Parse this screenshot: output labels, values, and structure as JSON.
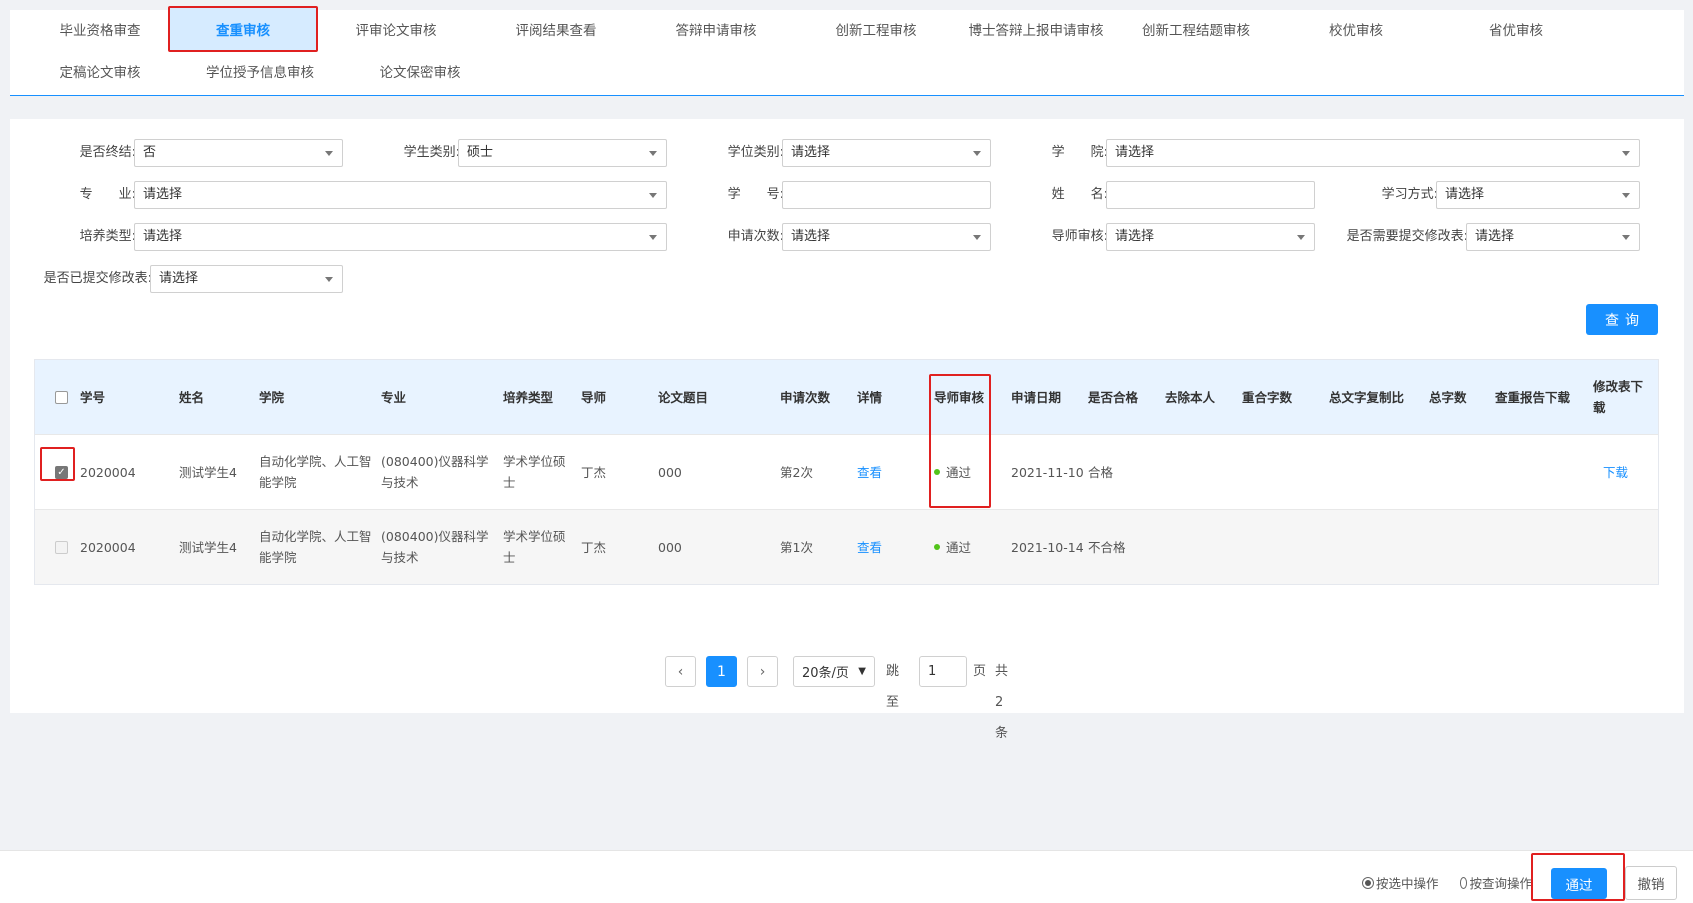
{
  "nav": {
    "tabs": [
      {
        "label": "毕业资格审查"
      },
      {
        "label": "查重审核"
      },
      {
        "label": "评审论文审核"
      },
      {
        "label": "评阅结果查看"
      },
      {
        "label": "答辩申请审核"
      },
      {
        "label": "创新工程审核"
      },
      {
        "label": "博士答辩上报申请审核"
      },
      {
        "label": "创新工程结题审核"
      },
      {
        "label": "校优审核"
      },
      {
        "label": "省优审核"
      },
      {
        "label": "定稿论文审核"
      },
      {
        "label": "学位授予信息审核"
      },
      {
        "label": "论文保密审核"
      }
    ],
    "active_tab": "查重审核"
  },
  "filters": {
    "is_final": {
      "label": "是否终结:",
      "value": "否"
    },
    "student_type": {
      "label": "学生类别:",
      "value": "硕士"
    },
    "degree_type": {
      "label": "学位类别:",
      "value": "请选择"
    },
    "college": {
      "label": "学　　院:",
      "value": "请选择"
    },
    "major": {
      "label": "专　　业:",
      "value": "请选择"
    },
    "student_no": {
      "label": "学　　号:",
      "value": ""
    },
    "name": {
      "label": "姓　　名:",
      "value": ""
    },
    "study_mode": {
      "label": "学习方式:",
      "value": "请选择"
    },
    "training_type": {
      "label": "培养类型:",
      "value": "请选择"
    },
    "apply_count": {
      "label": "申请次数:",
      "value": "请选择"
    },
    "tutor_review": {
      "label": "导师审核:",
      "value": "请选择"
    },
    "need_revision": {
      "label": "是否需要提交修改表:",
      "value": "请选择"
    },
    "revision_submitted": {
      "label": "是否已提交修改表:",
      "value": "请选择"
    }
  },
  "query_button": "查询",
  "table": {
    "headers": {
      "student_no": "学号",
      "name": "姓名",
      "college": "学院",
      "major": "专业",
      "training_type": "培养类型",
      "tutor": "导师",
      "thesis_title": "论文题目",
      "apply_count": "申请次数",
      "detail": "详情",
      "tutor_review": "导师审核",
      "apply_date": "申请日期",
      "qualified": "是否合格",
      "excluding_self": "去除本人",
      "overlap_words": "重合字数",
      "total_copy_ratio": "总文字复制比",
      "total_words": "总字数",
      "report_download": "查重报告下载",
      "revision_download": "修改表下载"
    },
    "rows": [
      {
        "checked": true,
        "disabled": false,
        "student_no": "2020004",
        "name": "测试学生4",
        "college": "自动化学院、人工智能学院",
        "major": "(080400)仪器科学与技术",
        "training_type": "学术学位硕士",
        "tutor": "丁杰",
        "thesis_title": "000",
        "apply_count": "第2次",
        "detail": "查看",
        "tutor_review": "通过",
        "apply_date": "2021-11-10",
        "qualified": "合格",
        "revision_download": "下载"
      },
      {
        "checked": false,
        "disabled": true,
        "student_no": "2020004",
        "name": "测试学生4",
        "college": "自动化学院、人工智能学院",
        "major": "(080400)仪器科学与技术",
        "training_type": "学术学位硕士",
        "tutor": "丁杰",
        "thesis_title": "000",
        "apply_count": "第1次",
        "detail": "查看",
        "tutor_review": "通过",
        "apply_date": "2021-10-14",
        "qualified": "不合格",
        "revision_download": ""
      }
    ]
  },
  "pagination": {
    "prev_icon": "chevron-left-icon",
    "next_icon": "chevron-right-icon",
    "current_page": "1",
    "page_size": "20条/页",
    "goto_label": "跳至",
    "goto_value": "1",
    "page_unit": "页",
    "total": "共2条"
  },
  "bottom": {
    "mode_selected": "按选中操作",
    "mode_query": "按查询操作",
    "pass_button": "通过",
    "revoke_button": "撤销"
  },
  "colors": {
    "accent": "#1890ff",
    "highlight": "#e02020",
    "status_ok": "#52c41a"
  }
}
